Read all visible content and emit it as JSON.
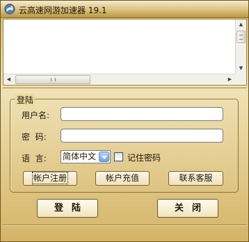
{
  "window": {
    "title": "云高速网游加速器 19.1",
    "icon": "app-logo-icon"
  },
  "log_area": {
    "lines": []
  },
  "login": {
    "group_label": "登陆",
    "username_label": "用户名:",
    "username_value": "",
    "password_label": "密  码:",
    "password_value": "",
    "language_label": "语  言:",
    "language_value": "简体中文",
    "remember_label": "记住密码",
    "remember_checked": false,
    "register_label": "帐户注册",
    "recharge_label": "帐户充值",
    "support_label": "联系客服"
  },
  "actions": {
    "login_label": "登陆",
    "close_label": "关闭"
  },
  "colors": {
    "frame": "#d6b96f",
    "frame_light": "#f0e2b5",
    "border": "#8e7030",
    "dropdown_accent": "#6f9fe6"
  }
}
